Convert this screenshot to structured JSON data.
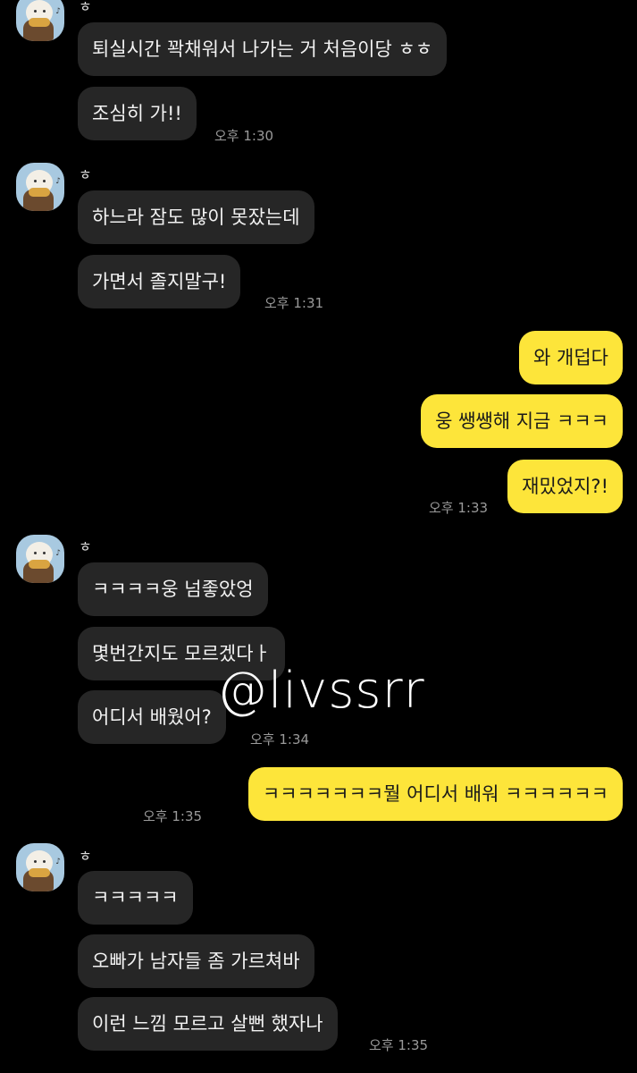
{
  "chat": {
    "groups": [
      {
        "name": "ㅎ",
        "messages": [
          "퇴실시간 꽉채워서 나가는 거 처음이당 ㅎㅎ",
          "조심히 가!!"
        ],
        "time": "오후 1:30"
      },
      {
        "name": "ㅎ",
        "messages": [
          "하느라 잠도 많이 못잤는데",
          "가면서 졸지말구!"
        ],
        "time": "오후 1:31"
      },
      {
        "mine": true,
        "messages": [
          "와 개덥다",
          "웅 쌩쌩해 지금 ㅋㅋㅋ",
          "재밌었지?!"
        ],
        "time": "오후 1:33"
      },
      {
        "name": "ㅎ",
        "messages": [
          "ㅋㅋㅋㅋ웅 넘좋았엉",
          "몇번간지도 모르겠다ㅏ",
          "어디서 배웠어?"
        ],
        "time": "오후 1:34"
      },
      {
        "mine": true,
        "messages": [
          "ㅋㅋㅋㅋㅋㅋㅋ뭘 어디서 배워 ㅋㅋㅋㅋㅋㅋ"
        ],
        "time": "오후 1:35"
      },
      {
        "name": "ㅎ",
        "messages": [
          "ㅋㅋㅋㅋㅋ",
          "오빠가 남자들 좀 가르쳐바",
          "이런 느낌 모르고 살뻔 했자나"
        ],
        "time": "오후 1:35"
      }
    ],
    "watermark": "@livssrr",
    "colors": {
      "mine_bubble": "#fde53a",
      "other_bubble": "#262626",
      "background": "#000000"
    }
  }
}
